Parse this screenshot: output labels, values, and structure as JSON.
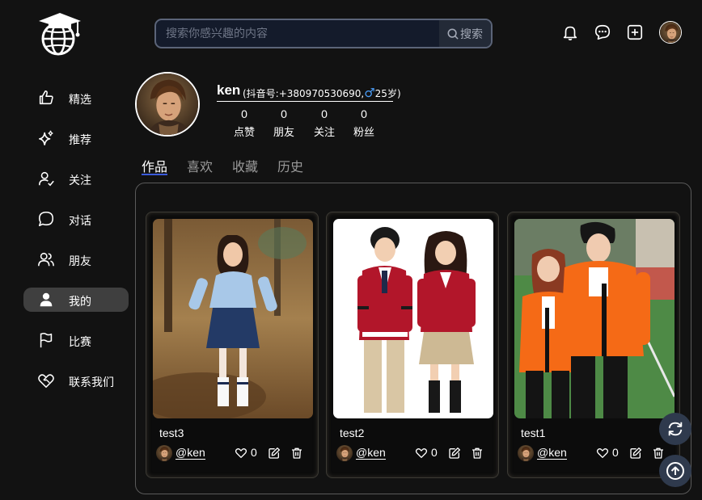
{
  "app": {
    "logo_icon": "graduation-globe-logo"
  },
  "header": {
    "search": {
      "placeholder": "搜索你感兴趣的内容",
      "value": "",
      "button_label": "搜索",
      "icon": "search-icon"
    },
    "icons": [
      "bell-icon",
      "chat-icon",
      "plus-square-icon"
    ],
    "avatar": "user-avatar"
  },
  "sidebar": {
    "items": [
      {
        "label": "精选",
        "icon": "thumbs-up-icon",
        "active": false
      },
      {
        "label": "推荐",
        "icon": "sparkle-icon",
        "active": false
      },
      {
        "label": "关注",
        "icon": "user-check-icon",
        "active": false
      },
      {
        "label": "对话",
        "icon": "chat-bubble-icon",
        "active": false
      },
      {
        "label": "朋友",
        "icon": "users-icon",
        "active": false
      },
      {
        "label": "我的",
        "icon": "user-solid-icon",
        "active": true
      },
      {
        "label": "比赛",
        "icon": "flag-icon",
        "active": false
      },
      {
        "label": "联系我们",
        "icon": "handshake-heart-icon",
        "active": false
      }
    ]
  },
  "profile": {
    "name": "ken",
    "meta_prefix": "(抖音号:+380970530690,",
    "gender_symbol": "♂",
    "meta_suffix": "25岁)",
    "stats": [
      {
        "value": "0",
        "label": "点赞"
      },
      {
        "value": "0",
        "label": "朋友"
      },
      {
        "value": "0",
        "label": "关注"
      },
      {
        "value": "0",
        "label": "粉丝"
      }
    ]
  },
  "tabs": [
    {
      "label": "作品",
      "active": true
    },
    {
      "label": "喜欢",
      "active": false
    },
    {
      "label": "收藏",
      "active": false
    },
    {
      "label": "历史",
      "active": false
    }
  ],
  "works": [
    {
      "title": "test3",
      "user": "@ken",
      "likes": "0",
      "image": "girl-in-school-uniform-outdoors"
    },
    {
      "title": "test2",
      "user": "@ken",
      "likes": "0",
      "image": "two-children-red-school-uniforms"
    },
    {
      "title": "test1",
      "user": "@ken",
      "likes": "0",
      "image": "two-students-orange-jackets"
    }
  ],
  "floating": [
    "refresh-icon",
    "scroll-top-icon"
  ],
  "colors": {
    "background": "#121212",
    "active_nav": "#3f3f3f",
    "tab_accent": "#3b5bdb",
    "male_symbol": "#4a9df8",
    "fab": "#2f3a4d"
  }
}
